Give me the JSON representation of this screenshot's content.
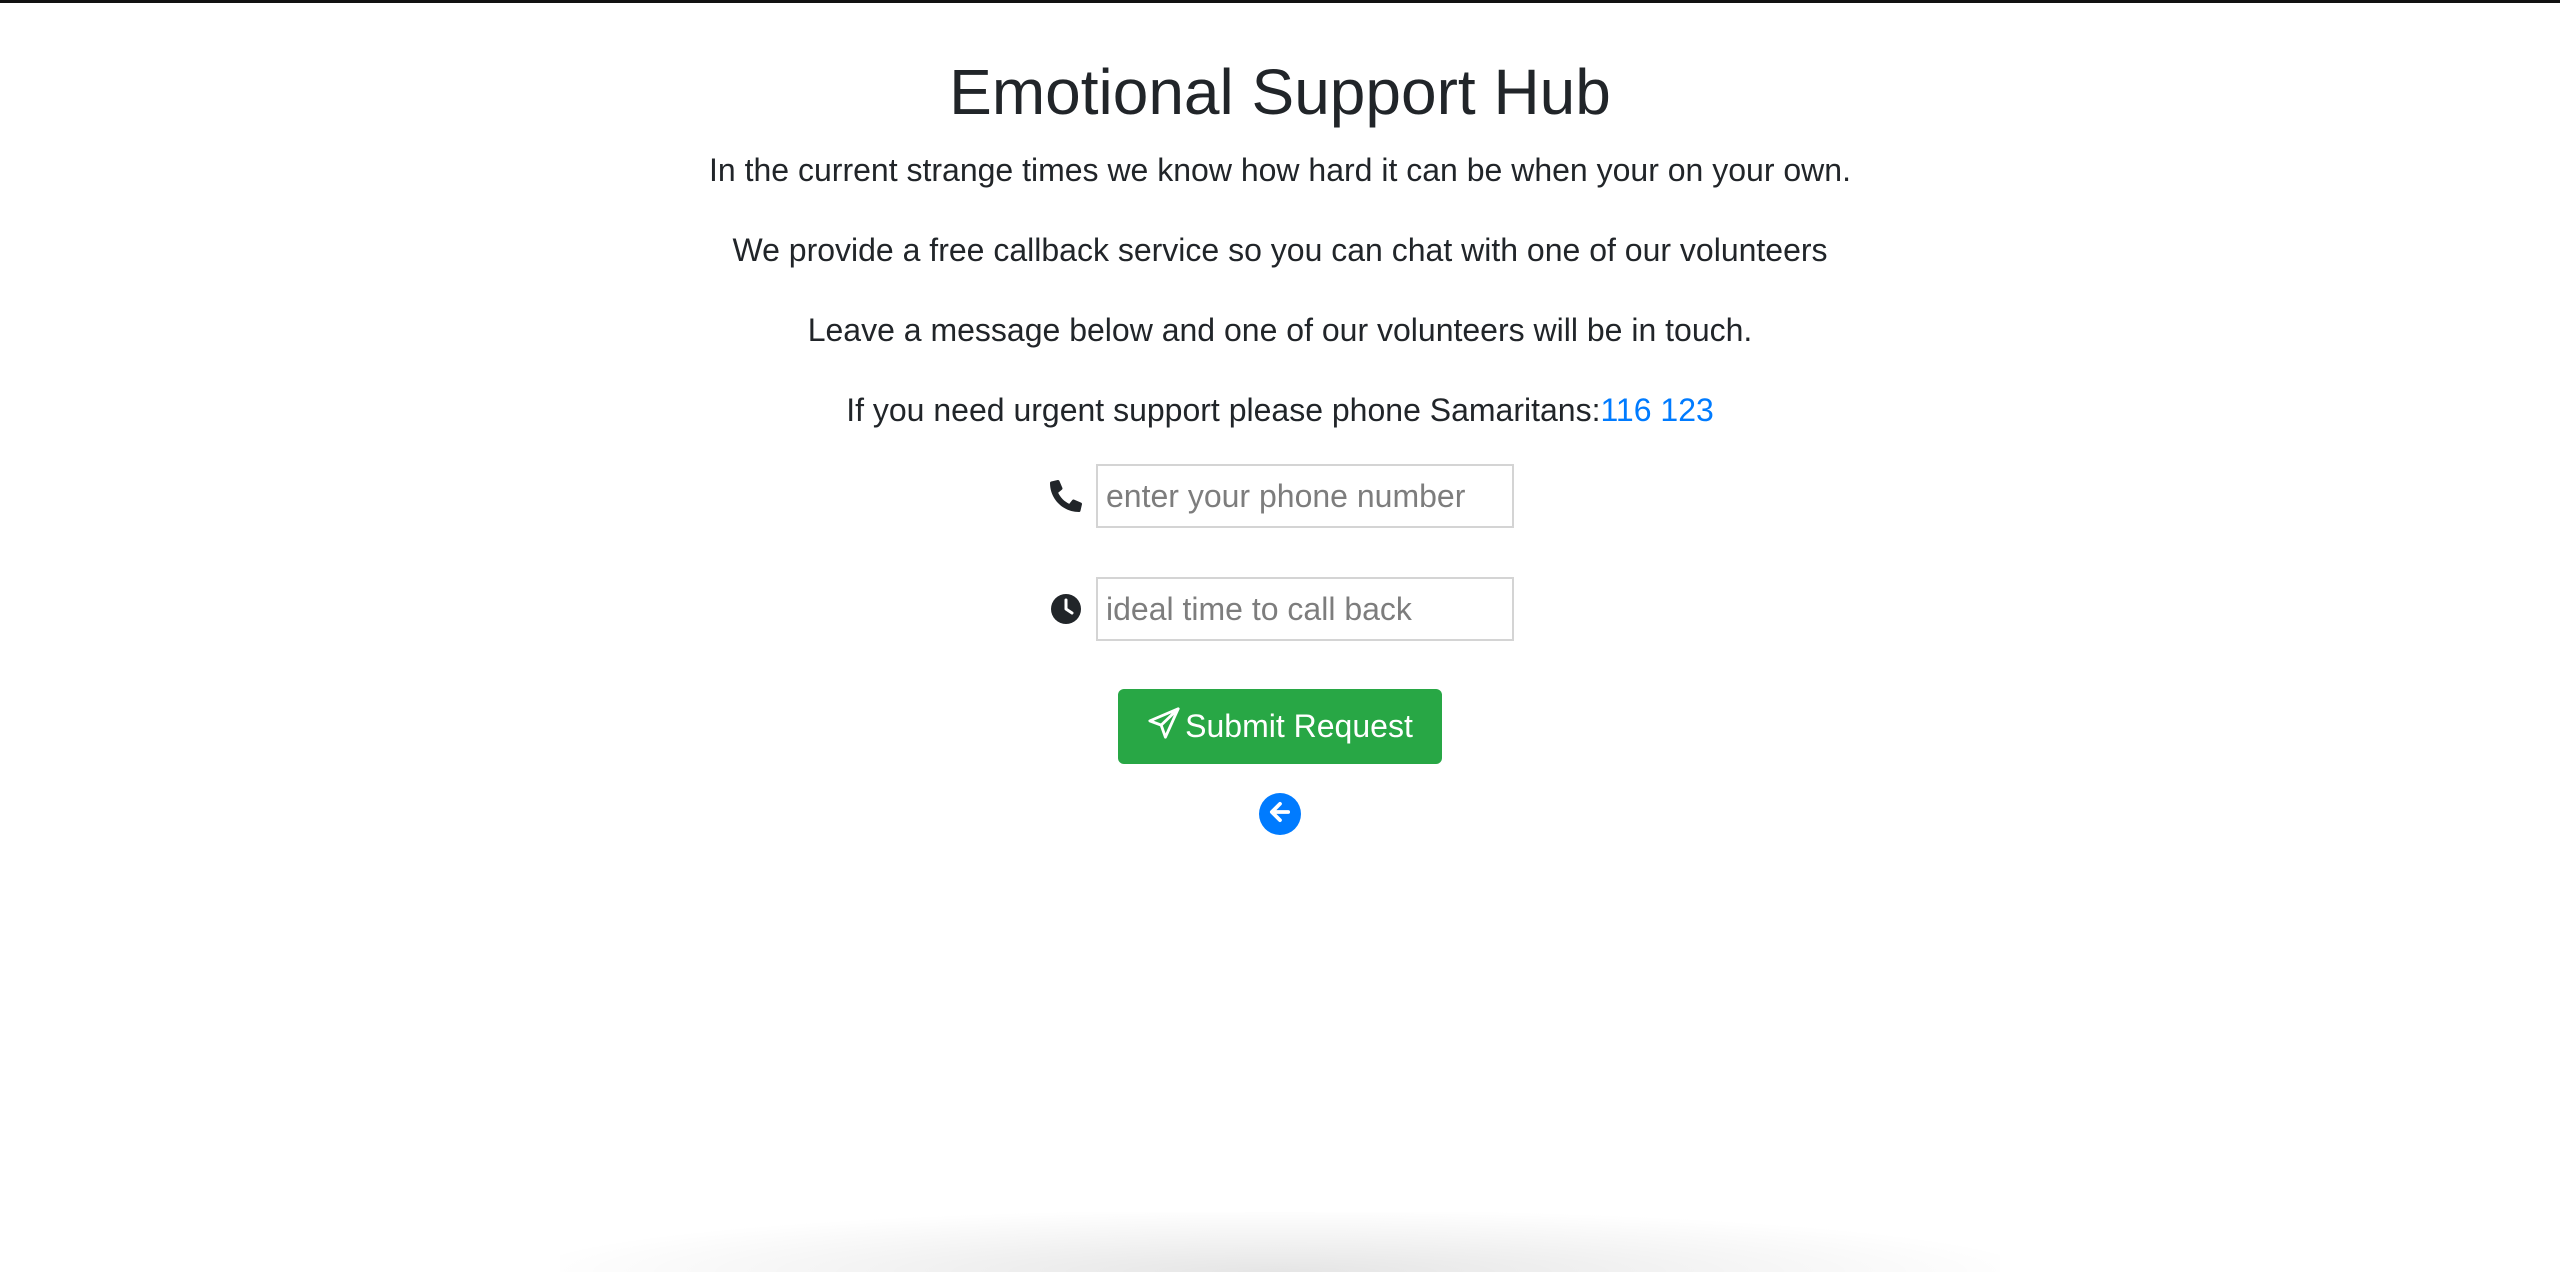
{
  "header": {
    "title": "Emotional Support Hub"
  },
  "intro": {
    "line1": "In the current strange times we know how hard it can be when your on your own.",
    "line2": "We provide a free callback service so you can chat with one of our volunteers",
    "line3": "Leave a message below and one of our volunteers will be in touch.",
    "urgent_prefix": "If you need urgent support please phone Samaritans:",
    "urgent_number": "116 123"
  },
  "form": {
    "phone": {
      "icon": "phone-icon",
      "placeholder": "enter your phone number",
      "value": ""
    },
    "time": {
      "icon": "clock-icon",
      "placeholder": "ideal time to call back",
      "value": ""
    },
    "submit_label": "Submit Request",
    "submit_icon": "paper-plane-icon",
    "back_icon": "arrow-circle-left-icon"
  },
  "colors": {
    "link": "#007bff",
    "submit": "#28a745",
    "back": "#007bff",
    "text": "#212529"
  }
}
